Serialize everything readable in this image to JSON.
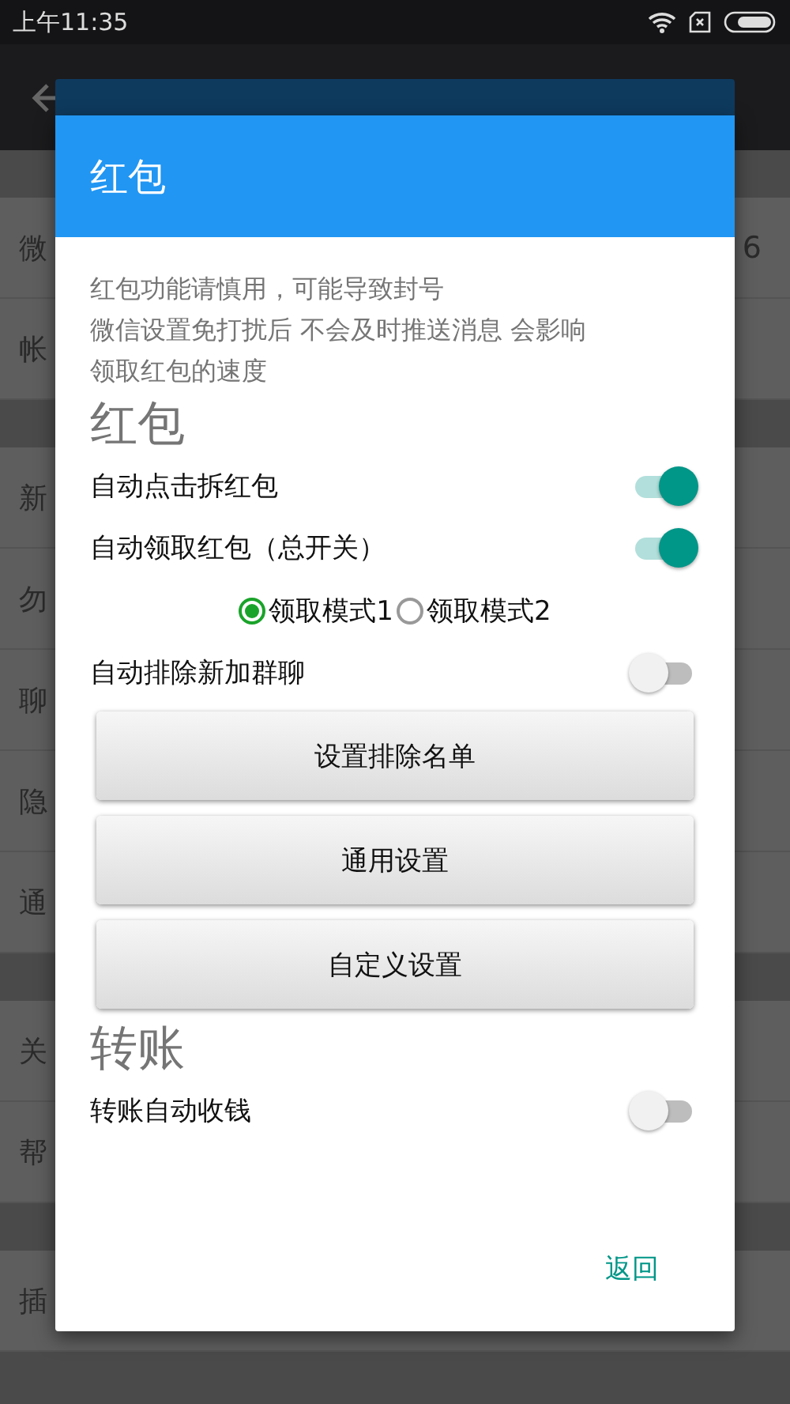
{
  "status_bar": {
    "time": "上午11:35"
  },
  "background": {
    "groups": [
      [
        {
          "label": "微",
          "value": "6"
        },
        {
          "label": "帐"
        }
      ],
      [
        {
          "label": "新"
        },
        {
          "label": "勿"
        },
        {
          "label": "聊"
        },
        {
          "label": "隐"
        },
        {
          "label": "通"
        }
      ],
      [
        {
          "label": "关"
        },
        {
          "label": "帮"
        }
      ],
      [
        {
          "label": "插"
        }
      ]
    ]
  },
  "dialog": {
    "title": "红包",
    "message_lines": [
      "红包功能请慎用，可能导致封号",
      "微信设置免打扰后 不会及时推送消息 会影响",
      "领取红包的速度"
    ],
    "sections": [
      {
        "title": "红包",
        "items": [
          {
            "kind": "switch",
            "label": "自动点击拆红包",
            "on": true
          },
          {
            "kind": "switch",
            "label": "自动领取红包（总开关）",
            "on": true
          },
          {
            "kind": "radio_group",
            "options": [
              {
                "label": "领取模式1",
                "selected": true
              },
              {
                "label": "领取模式2",
                "selected": false
              }
            ]
          },
          {
            "kind": "switch",
            "label": "自动排除新加群聊",
            "on": false
          },
          {
            "kind": "button",
            "label": "设置排除名单"
          },
          {
            "kind": "button",
            "label": "通用设置"
          },
          {
            "kind": "button",
            "label": "自定义设置"
          }
        ]
      },
      {
        "title": "转账",
        "items": [
          {
            "kind": "switch",
            "label": "转账自动收钱",
            "on": false
          }
        ]
      }
    ],
    "actions": [
      "返回"
    ]
  }
}
